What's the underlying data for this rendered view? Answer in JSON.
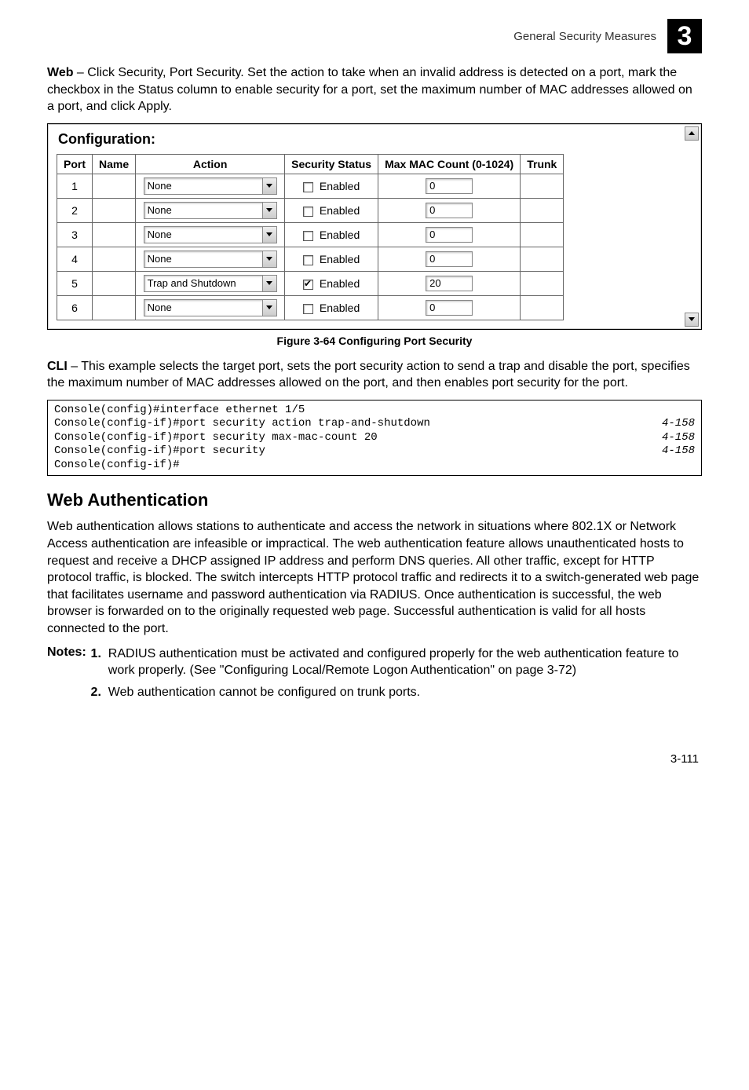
{
  "header": {
    "title": "General Security Measures",
    "chapter_num": "3"
  },
  "intro_web": {
    "prefix": "Web",
    "text": " – Click Security, Port Security. Set the action to take when an invalid address is detected on a port, mark the checkbox in the Status column to enable security for a port, set the maximum number of MAC addresses allowed on a port, and click Apply."
  },
  "screenshot": {
    "title": "Configuration:",
    "columns": [
      "Port",
      "Name",
      "Action",
      "Security Status",
      "Max MAC Count (0-1024)",
      "Trunk"
    ],
    "status_label": "Enabled",
    "rows": [
      {
        "port": "1",
        "name": "",
        "action": "None",
        "checked": false,
        "max": "0",
        "trunk": ""
      },
      {
        "port": "2",
        "name": "",
        "action": "None",
        "checked": false,
        "max": "0",
        "trunk": ""
      },
      {
        "port": "3",
        "name": "",
        "action": "None",
        "checked": false,
        "max": "0",
        "trunk": ""
      },
      {
        "port": "4",
        "name": "",
        "action": "None",
        "checked": false,
        "max": "0",
        "trunk": ""
      },
      {
        "port": "5",
        "name": "",
        "action": "Trap and Shutdown",
        "checked": true,
        "max": "20",
        "trunk": ""
      },
      {
        "port": "6",
        "name": "",
        "action": "None",
        "checked": false,
        "max": "0",
        "trunk": ""
      }
    ]
  },
  "figure_caption": "Figure 3-64  Configuring Port Security",
  "intro_cli": {
    "prefix": "CLI",
    "text": " – This example selects the target port, sets the port security action to send a trap and disable the port, specifies the maximum number of MAC addresses allowed on the port, and then enables port security for the port."
  },
  "code_lines": [
    {
      "cmd": "Console(config)#interface ethernet 1/5",
      "ref": ""
    },
    {
      "cmd": "Console(config-if)#port security action trap-and-shutdown",
      "ref": "4-158"
    },
    {
      "cmd": "Console(config-if)#port security max-mac-count 20",
      "ref": "4-158"
    },
    {
      "cmd": "Console(config-if)#port security",
      "ref": "4-158"
    },
    {
      "cmd": "Console(config-if)#",
      "ref": ""
    }
  ],
  "web_auth": {
    "heading": "Web Authentication",
    "paragraph": "Web authentication allows stations to authenticate and access the network in situations where 802.1X or Network Access authentication are infeasible or impractical. The web authentication feature allows unauthenticated hosts to request and receive a DHCP assigned IP address and perform DNS queries. All other traffic, except for HTTP protocol traffic, is blocked. The switch intercepts HTTP protocol traffic and redirects it to a switch-generated web page that facilitates username and password authentication via RADIUS. Once authentication is successful, the web browser is forwarded on to the originally requested web page. Successful authentication is valid for all hosts connected to the port."
  },
  "notes": {
    "label": "Notes:",
    "items": [
      "RADIUS authentication must be activated and configured properly for the web authentication feature to work properly. (See \"Configuring Local/Remote Logon Authentication\" on page 3-72)",
      "Web authentication cannot be configured on trunk ports."
    ]
  },
  "page_number": "3-111"
}
